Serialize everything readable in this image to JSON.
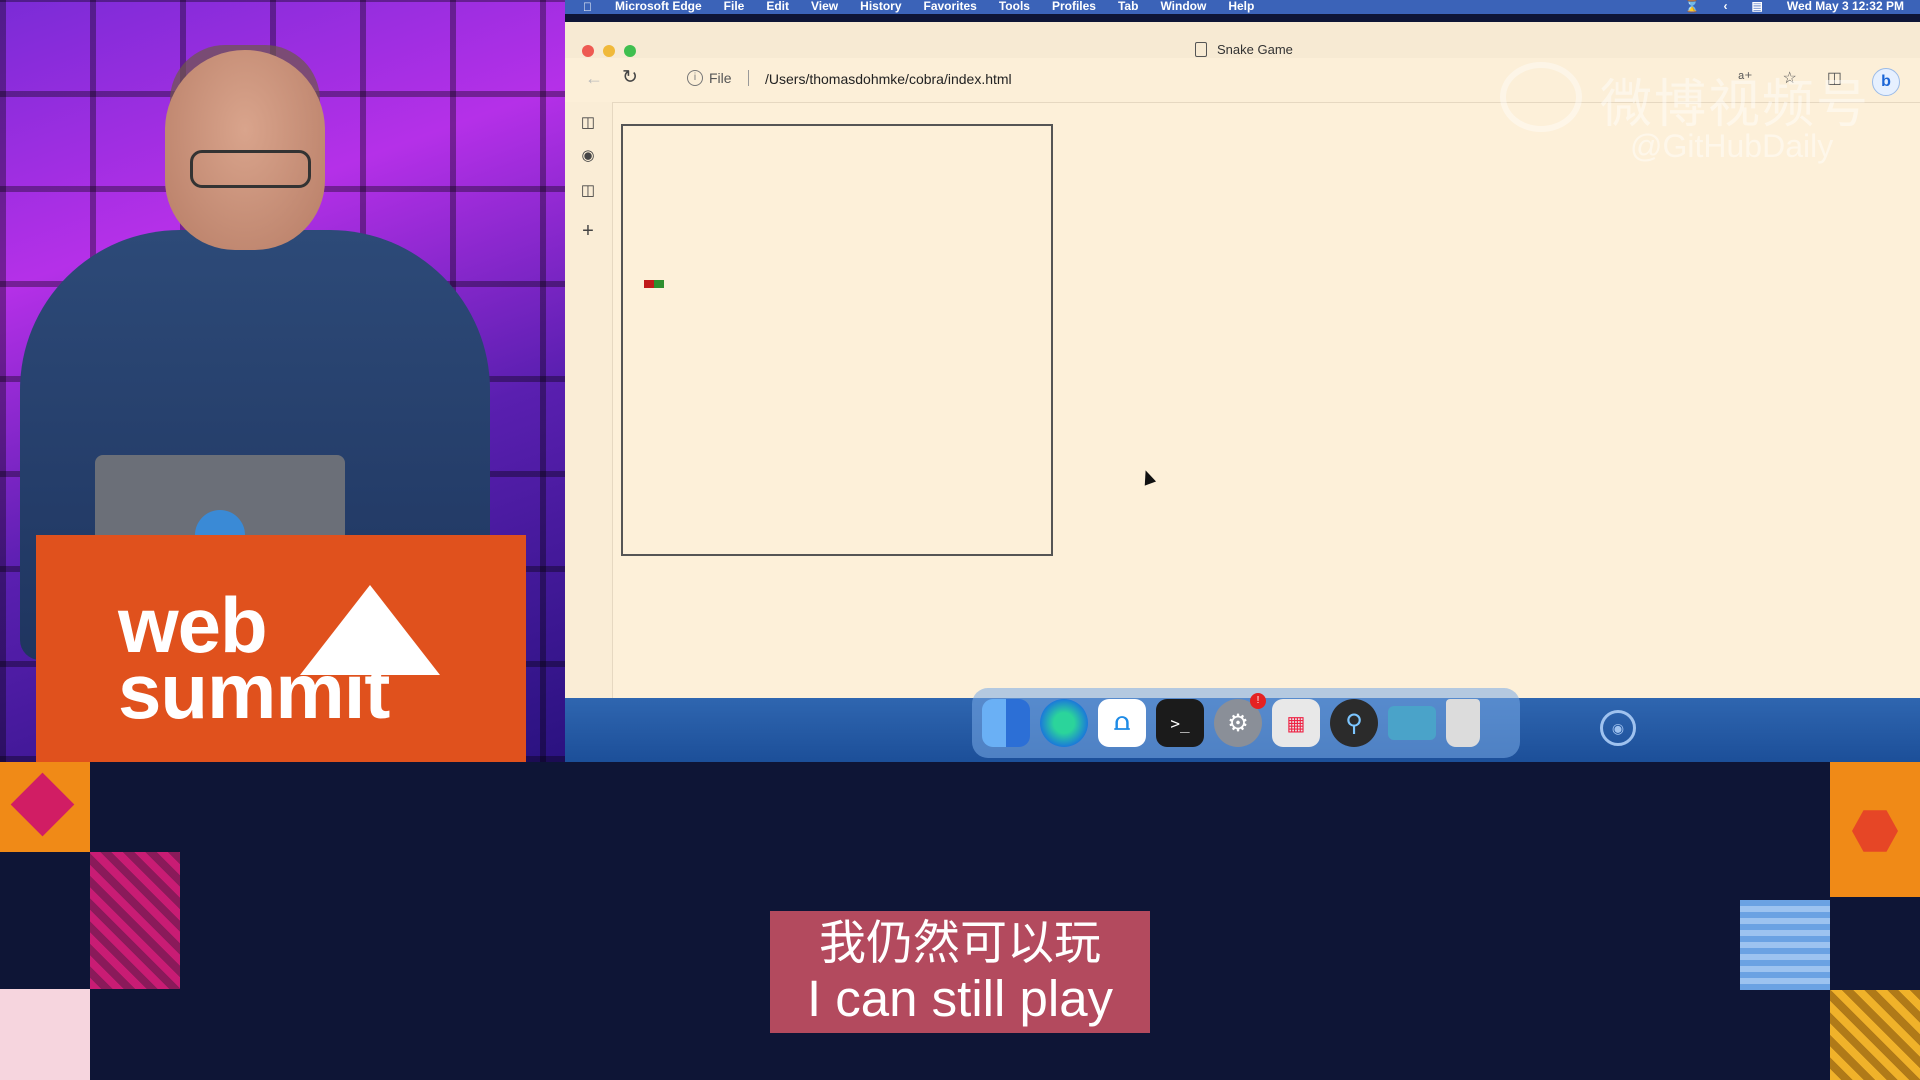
{
  "menubar": {
    "app_name": "Microsoft Edge",
    "menus": [
      "File",
      "Edit",
      "View",
      "History",
      "Favorites",
      "Tools",
      "Profiles",
      "Tab",
      "Window",
      "Help"
    ],
    "datetime": "Wed May 3  12:32 PM"
  },
  "browser": {
    "tab_title": "Snake Game",
    "protocol_label": "File",
    "url": "/Users/thomasdohmke/cobra/index.html",
    "bing_label": "b"
  },
  "podium": {
    "logo_line1": "web",
    "logo_line2": "summit"
  },
  "watermark": {
    "title": "微博视频号",
    "handle": "@GitHubDaily"
  },
  "subtitle": {
    "chinese": "我仍然可以玩",
    "english": "I can still play"
  },
  "colors": {
    "menubar": "#3b63b8",
    "window_bg": "#fdf0d9",
    "subtitle_bg": "#b34a5e",
    "background": "#0e1536"
  }
}
